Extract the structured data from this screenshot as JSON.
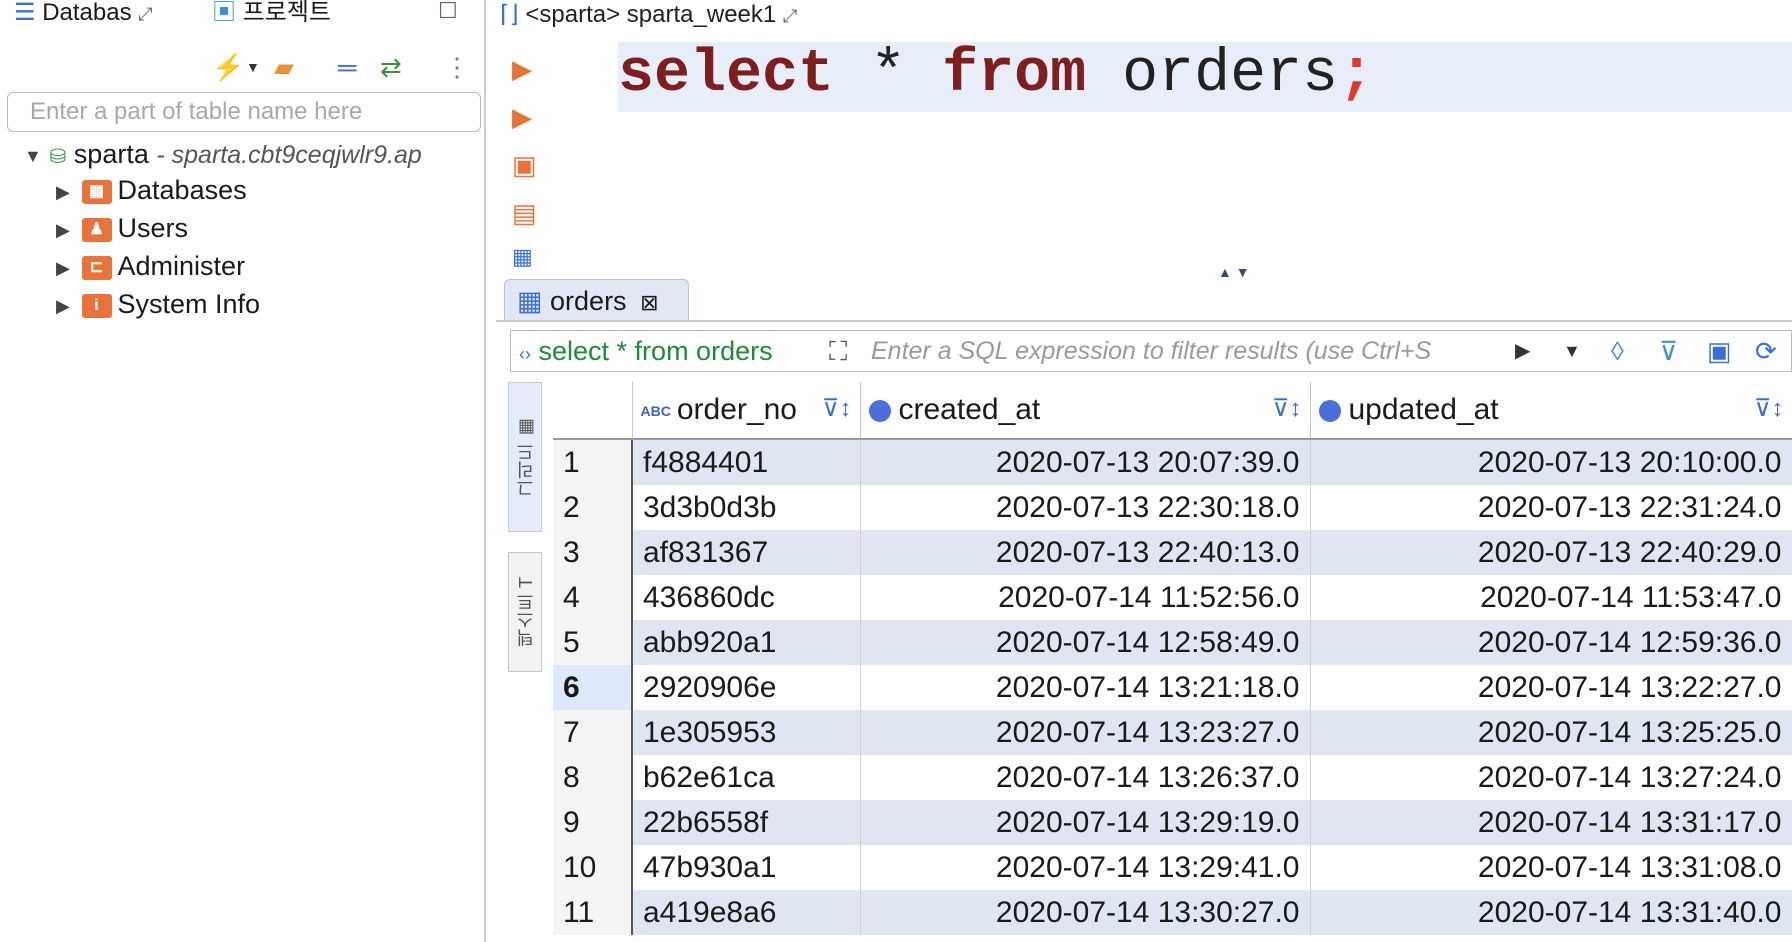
{
  "left_panel": {
    "tabs": [
      "Databas",
      "프로젝트"
    ],
    "search_placeholder": "Enter a part of table name here",
    "connection": {
      "name": "sparta",
      "host": "- sparta.cbt9ceqjwlr9.ap"
    },
    "items": [
      {
        "label": "Databases",
        "icon": "database-folder-icon"
      },
      {
        "label": "Users",
        "icon": "users-icon"
      },
      {
        "label": "Administer",
        "icon": "administer-icon"
      },
      {
        "label": "System Info",
        "icon": "system-info-icon"
      }
    ]
  },
  "editor": {
    "tab_title": "<sparta> sparta_week1",
    "sql": {
      "kw1": "select",
      "op": "*",
      "kw2": "from",
      "table": "orders",
      "semi": ";"
    }
  },
  "results": {
    "tab_label": "orders",
    "query": "select * from orders",
    "filter_placeholder": "Enter a SQL expression to filter results (use Ctrl+S",
    "side_tabs": [
      "그리드",
      "텍스트"
    ],
    "columns": [
      "order_no",
      "created_at",
      "updated_at"
    ],
    "selected_row": 6,
    "rows": [
      {
        "n": "1",
        "order_no": "f4884401",
        "created_at": "2020-07-13 20:07:39.0",
        "updated_at": "2020-07-13 20:10:00.0"
      },
      {
        "n": "2",
        "order_no": "3d3b0d3b",
        "created_at": "2020-07-13 22:30:18.0",
        "updated_at": "2020-07-13 22:31:24.0"
      },
      {
        "n": "3",
        "order_no": "af831367",
        "created_at": "2020-07-13 22:40:13.0",
        "updated_at": "2020-07-13 22:40:29.0"
      },
      {
        "n": "4",
        "order_no": "436860dc",
        "created_at": "2020-07-14 11:52:56.0",
        "updated_at": "2020-07-14 11:53:47.0"
      },
      {
        "n": "5",
        "order_no": "abb920a1",
        "created_at": "2020-07-14 12:58:49.0",
        "updated_at": "2020-07-14 12:59:36.0"
      },
      {
        "n": "6",
        "order_no": "2920906e",
        "created_at": "2020-07-14 13:21:18.0",
        "updated_at": "2020-07-14 13:22:27.0"
      },
      {
        "n": "7",
        "order_no": "1e305953",
        "created_at": "2020-07-14 13:23:27.0",
        "updated_at": "2020-07-14 13:25:25.0"
      },
      {
        "n": "8",
        "order_no": "b62e61ca",
        "created_at": "2020-07-14 13:26:37.0",
        "updated_at": "2020-07-14 13:27:24.0"
      },
      {
        "n": "9",
        "order_no": "22b6558f",
        "created_at": "2020-07-14 13:29:19.0",
        "updated_at": "2020-07-14 13:31:17.0"
      },
      {
        "n": "10",
        "order_no": "47b930a1",
        "created_at": "2020-07-14 13:29:41.0",
        "updated_at": "2020-07-14 13:31:08.0"
      },
      {
        "n": "11",
        "order_no": "a419e8a6",
        "created_at": "2020-07-14 13:30:27.0",
        "updated_at": "2020-07-14 13:31:40.0"
      }
    ]
  },
  "colors": {
    "accent": "#3a6fd8",
    "keyword": "#7f1e1e",
    "row_stripe": "#dfe6f1",
    "query_green": "#1f8a3a"
  }
}
